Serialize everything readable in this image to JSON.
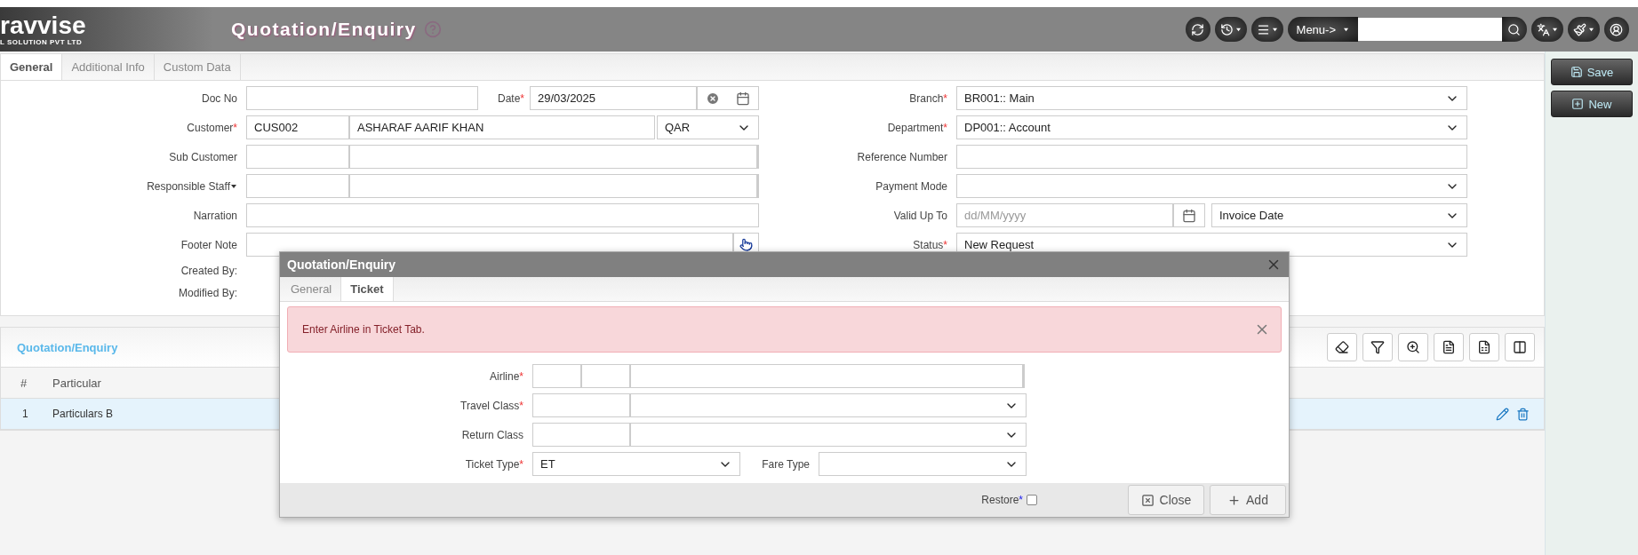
{
  "header": {
    "logo": {
      "name": "ravvise",
      "tagline": "L SOLUTION PVT LTD"
    },
    "title": "Quotation/Enquiry",
    "menu_button": "Menu->"
  },
  "tabs": [
    {
      "label": "General",
      "selected": true
    },
    {
      "label": "Additional Info",
      "selected": false
    },
    {
      "label": "Custom Data",
      "selected": false
    }
  ],
  "left_fields": [
    {
      "kind": "text_date",
      "label": "Doc No",
      "date_label": "Date",
      "date_mark": "*",
      "date_value": "29/03/2025"
    },
    {
      "kind": "pair_select",
      "label": "Customer",
      "mark": "*",
      "code": "CUS002",
      "name": "ASHARAF AARIF KHAN",
      "select": "QAR"
    },
    {
      "kind": "pair",
      "label": "Sub Customer"
    },
    {
      "kind": "pair",
      "label": "Responsible Staff",
      "has_menu": true
    },
    {
      "kind": "textarea",
      "label": "Narration"
    },
    {
      "kind": "text_button",
      "label": "Footer Note"
    },
    {
      "kind": "info",
      "label": "Created By:"
    },
    {
      "kind": "info",
      "label": "Modified By:"
    }
  ],
  "right_fields": [
    {
      "kind": "select",
      "label": "Branch",
      "mark": "*",
      "value": "BR001:: Main"
    },
    {
      "kind": "select",
      "label": "Department",
      "mark": "*",
      "value": "DP001:: Account"
    },
    {
      "kind": "text",
      "label": "Reference Number"
    },
    {
      "kind": "select",
      "label": "Payment Mode"
    },
    {
      "kind": "date_select",
      "label": "Valid Up To",
      "placeholder": "dd/MM/yyyy",
      "value": "Invoice Date"
    },
    {
      "kind": "select",
      "label": "Status",
      "mark": "*",
      "value": "New Request"
    }
  ],
  "side_buttons": [
    {
      "kind": "save",
      "label": "Save"
    },
    {
      "kind": "new",
      "label": "New"
    }
  ],
  "table": {
    "title": "Quotation/Enquiry",
    "columns": [
      "#",
      "Particular"
    ],
    "rows": [
      {
        "num": "1",
        "particular": "Particulars B"
      }
    ]
  },
  "modal": {
    "title": "Quotation/Enquiry",
    "tabs": [
      {
        "label": "General",
        "selected": false
      },
      {
        "label": "Ticket",
        "selected": true
      }
    ],
    "alert": "Enter Airline in Ticket Tab.",
    "fields": [
      {
        "kind": "triple",
        "label": "Airline",
        "mark": "*"
      },
      {
        "kind": "pair_select",
        "label": "Travel Class",
        "mark": "*"
      },
      {
        "kind": "pair_select",
        "label": "Return Class"
      },
      {
        "kind": "two_selects",
        "label": "Ticket Type",
        "mark": "*",
        "value": "ET",
        "second_label": "Fare Type"
      }
    ],
    "restore": {
      "label": "Restore",
      "mark": "*",
      "checked": false
    },
    "buttons": [
      {
        "kind": "close",
        "label": "Close"
      },
      {
        "kind": "add",
        "label": "Add"
      }
    ]
  }
}
